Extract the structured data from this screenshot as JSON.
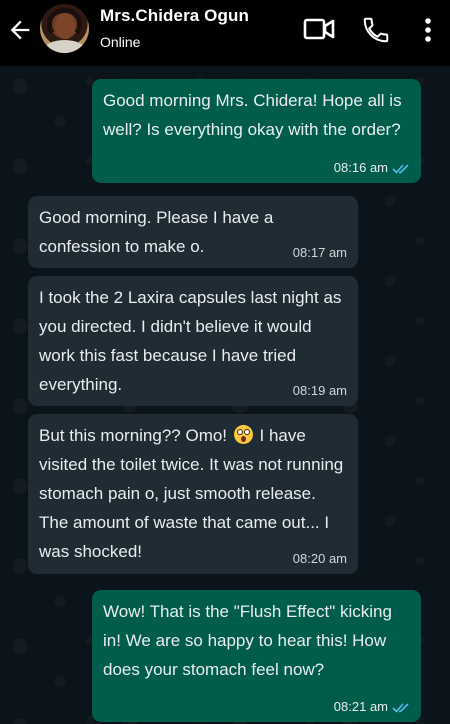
{
  "header": {
    "contact_name": "Mrs.Chidera Ogun",
    "status": "Online",
    "icons": [
      "back-arrow-icon",
      "avatar",
      "video-call-icon",
      "phone-call-icon",
      "more-options-icon"
    ]
  },
  "colors": {
    "header_bg": "#000000",
    "chat_bg": "#0b141a",
    "incoming_bubble": "#1f2c34",
    "outgoing_bubble": "#005c4b",
    "read_ticks": "#53bdeb"
  },
  "messages": [
    {
      "direction": "out",
      "text": "Good morning Mrs. Chidera! Hope all is well? Is everything okay with the order?",
      "time": "08:16 am",
      "status": "read"
    },
    {
      "direction": "in",
      "text": "Good morning. Please I have a confession to make o.",
      "time": "08:17 am"
    },
    {
      "direction": "in",
      "text": "I took the 2 Laxira capsules last night as you directed. I didn't believe it would work this fast because I have tried everything.",
      "time": "08:19 am"
    },
    {
      "direction": "in",
      "text_before_emoji": "But this morning?? Omo!",
      "emoji": "flushed-face-emoji",
      "text_after_emoji": "I have visited the toilet twice. It was not running stomach pain o, just smooth release. The amount of waste that came out... I was shocked!",
      "time": "08:20 am"
    },
    {
      "direction": "out",
      "text": "Wow! That is the \"Flush Effect\" kicking in! We are so happy to hear this! How does your stomach feel now?",
      "time": "08:21 am",
      "status": "read"
    }
  ]
}
